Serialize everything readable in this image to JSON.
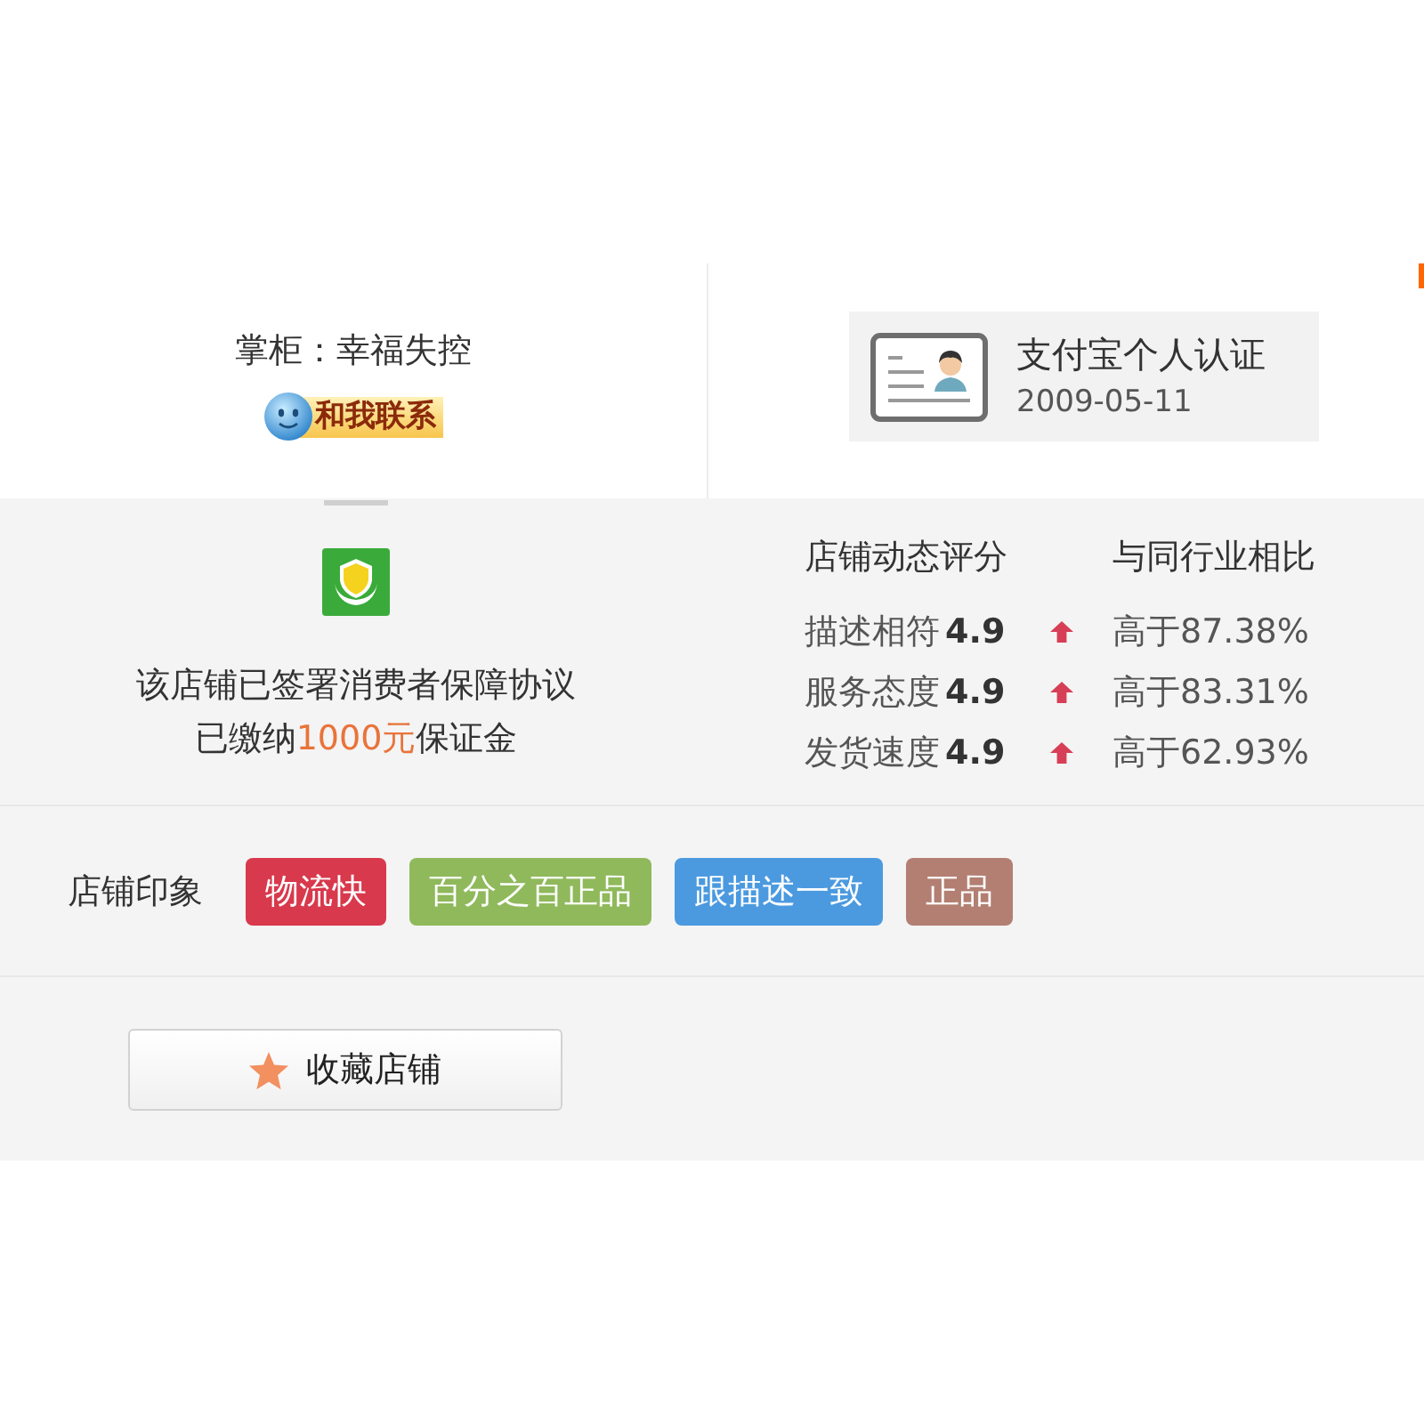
{
  "shopkeeper": {
    "label": "掌柜：幸福失控",
    "contact_button": "和我联系"
  },
  "certification": {
    "title": "支付宝个人认证",
    "date": "2009-05-11"
  },
  "guarantee": {
    "line_1": "该店铺已签署消费者保障协议",
    "line_2": {
      "prefix": "已缴纳",
      "amount": "1000元",
      "suffix": "保证金"
    }
  },
  "ratings": {
    "header": "店铺动态评分",
    "compare_header": "与同行业相比",
    "rows": [
      {
        "name": "描述相符",
        "score": "4.9",
        "higher": true,
        "compare": "高于87.38%"
      },
      {
        "name": "服务态度",
        "score": "4.9",
        "higher": true,
        "compare": "高于83.31%"
      },
      {
        "name": "发货速度",
        "score": "4.9",
        "higher": true,
        "compare": "高于62.93%"
      }
    ]
  },
  "impressions": {
    "label": "店铺印象",
    "tags": [
      {
        "text": "物流快",
        "color": "#d8394c"
      },
      {
        "text": "百分之百正品",
        "color": "#8fb95b"
      },
      {
        "text": "跟描述一致",
        "color": "#4b9ae0"
      },
      {
        "text": "正品",
        "color": "#b27f72"
      }
    ]
  },
  "favorite_button": "收藏店铺"
}
